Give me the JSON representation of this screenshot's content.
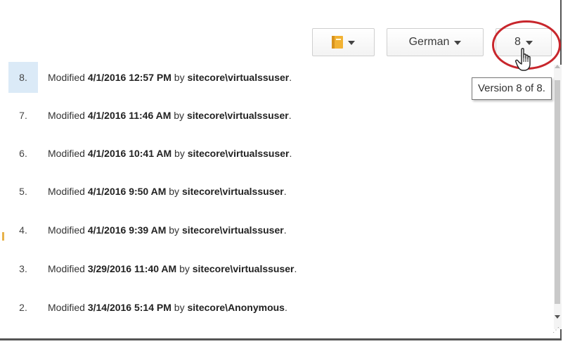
{
  "toolbar": {
    "item_icon": "book-icon",
    "language_label": "German",
    "version_label": "8"
  },
  "tooltip": "Version 8 of 8.",
  "versions": [
    {
      "num": "8.",
      "prefix": "Modified",
      "date": "4/1/2016 12:57 PM",
      "by": "by",
      "user": "sitecore\\virtualssuser",
      "end": "."
    },
    {
      "num": "7.",
      "prefix": "Modified",
      "date": "4/1/2016 11:46 AM",
      "by": "by",
      "user": "sitecore\\virtualssuser",
      "end": "."
    },
    {
      "num": "6.",
      "prefix": "Modified",
      "date": "4/1/2016 10:41 AM",
      "by": "by",
      "user": "sitecore\\virtualssuser",
      "end": "."
    },
    {
      "num": "5.",
      "prefix": "Modified",
      "date": "4/1/2016 9:50 AM",
      "by": "by",
      "user": "sitecore\\virtualssuser",
      "end": "."
    },
    {
      "num": "4.",
      "prefix": "Modified",
      "date": "4/1/2016 9:39 AM",
      "by": "by",
      "user": "sitecore\\virtualssuser",
      "end": "."
    },
    {
      "num": "3.",
      "prefix": "Modified",
      "date": "3/29/2016 11:40 AM",
      "by": "by",
      "user": "sitecore\\virtualssuser",
      "end": "."
    },
    {
      "num": "2.",
      "prefix": "Modified",
      "date": "3/14/2016 5:14 PM",
      "by": "by",
      "user": "sitecore\\Anonymous",
      "end": "."
    }
  ],
  "colors": {
    "selected_row": "#dbeaf7",
    "highlight_ring": "#c8262c"
  }
}
